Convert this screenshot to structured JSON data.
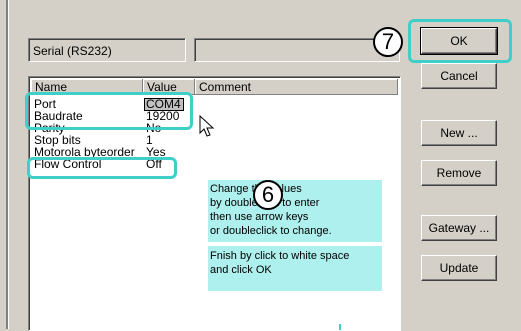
{
  "interface_field": "Serial (RS232)",
  "second_field": "",
  "columns": {
    "name": "Name",
    "value": "Value",
    "comment": "Comment"
  },
  "rows": [
    {
      "name": "Port",
      "value": "COM4"
    },
    {
      "name": "Baudrate",
      "value": "19200"
    },
    {
      "name": "Parity",
      "value": "No"
    },
    {
      "name": "Stop bits",
      "value": "1"
    },
    {
      "name": "Motorola byteorder",
      "value": "Yes"
    },
    {
      "name": "Flow Control",
      "value": "Off"
    }
  ],
  "buttons": {
    "ok": "OK",
    "cancel": "Cancel",
    "new": "New ...",
    "remove": "Remove",
    "gateway": "Gateway ...",
    "update": "Update"
  },
  "callout": {
    "line1": "Change the values",
    "line2": "by doubleclick to enter",
    "line3": "then use arrow keys",
    "line4": "or doubleclick to change.",
    "line5": "Fnish by click to white space",
    "line6": "and click OK"
  },
  "badges": {
    "step6": "6",
    "step7": "7"
  },
  "colors": {
    "highlight": "#3fcfc8",
    "callout_bg": "#aef0ee",
    "dialog_bg": "#d4d0c8"
  }
}
